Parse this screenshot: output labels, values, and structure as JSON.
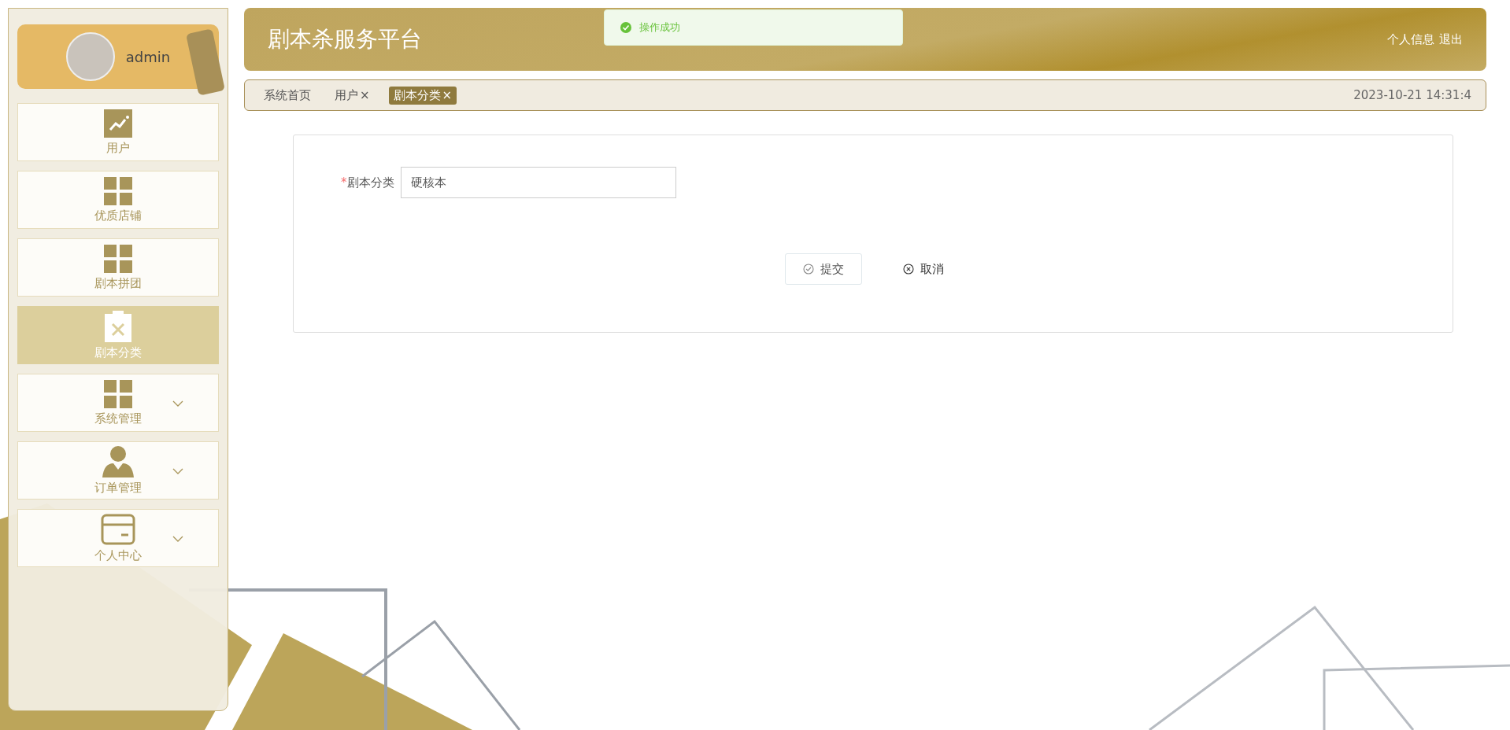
{
  "sidebar": {
    "user": {
      "name": "admin"
    },
    "items": [
      {
        "label": "用户",
        "kind": "chart",
        "selected": false,
        "expandable": false
      },
      {
        "label": "优质店铺",
        "kind": "grid",
        "selected": false,
        "expandable": false
      },
      {
        "label": "剧本拼团",
        "kind": "grid",
        "selected": false,
        "expandable": false
      },
      {
        "label": "剧本分类",
        "kind": "clipboard",
        "selected": true,
        "expandable": false
      },
      {
        "label": "系统管理",
        "kind": "grid",
        "selected": false,
        "expandable": true
      },
      {
        "label": "订单管理",
        "kind": "person",
        "selected": false,
        "expandable": true
      },
      {
        "label": "个人中心",
        "kind": "card",
        "selected": false,
        "expandable": true
      }
    ]
  },
  "header": {
    "title": "剧本杀服务平台",
    "links": [
      "个人信息",
      "退出"
    ]
  },
  "toast": {
    "message": "操作成功"
  },
  "tabs": [
    {
      "label": "系统首页",
      "selected": false
    },
    {
      "label": "用户",
      "close": "×",
      "selected": false
    },
    {
      "label": "剧本分类",
      "close": "×",
      "selected": true
    }
  ],
  "datetime": "2023-10-21 14:31:4",
  "form": {
    "fields": [
      {
        "label": "剧本分类",
        "required_mark": "*",
        "value": "硬核本"
      }
    ],
    "buttons": [
      {
        "label": "提交",
        "kind": "submit"
      },
      {
        "label": "取消",
        "kind": "cancel"
      }
    ]
  }
}
